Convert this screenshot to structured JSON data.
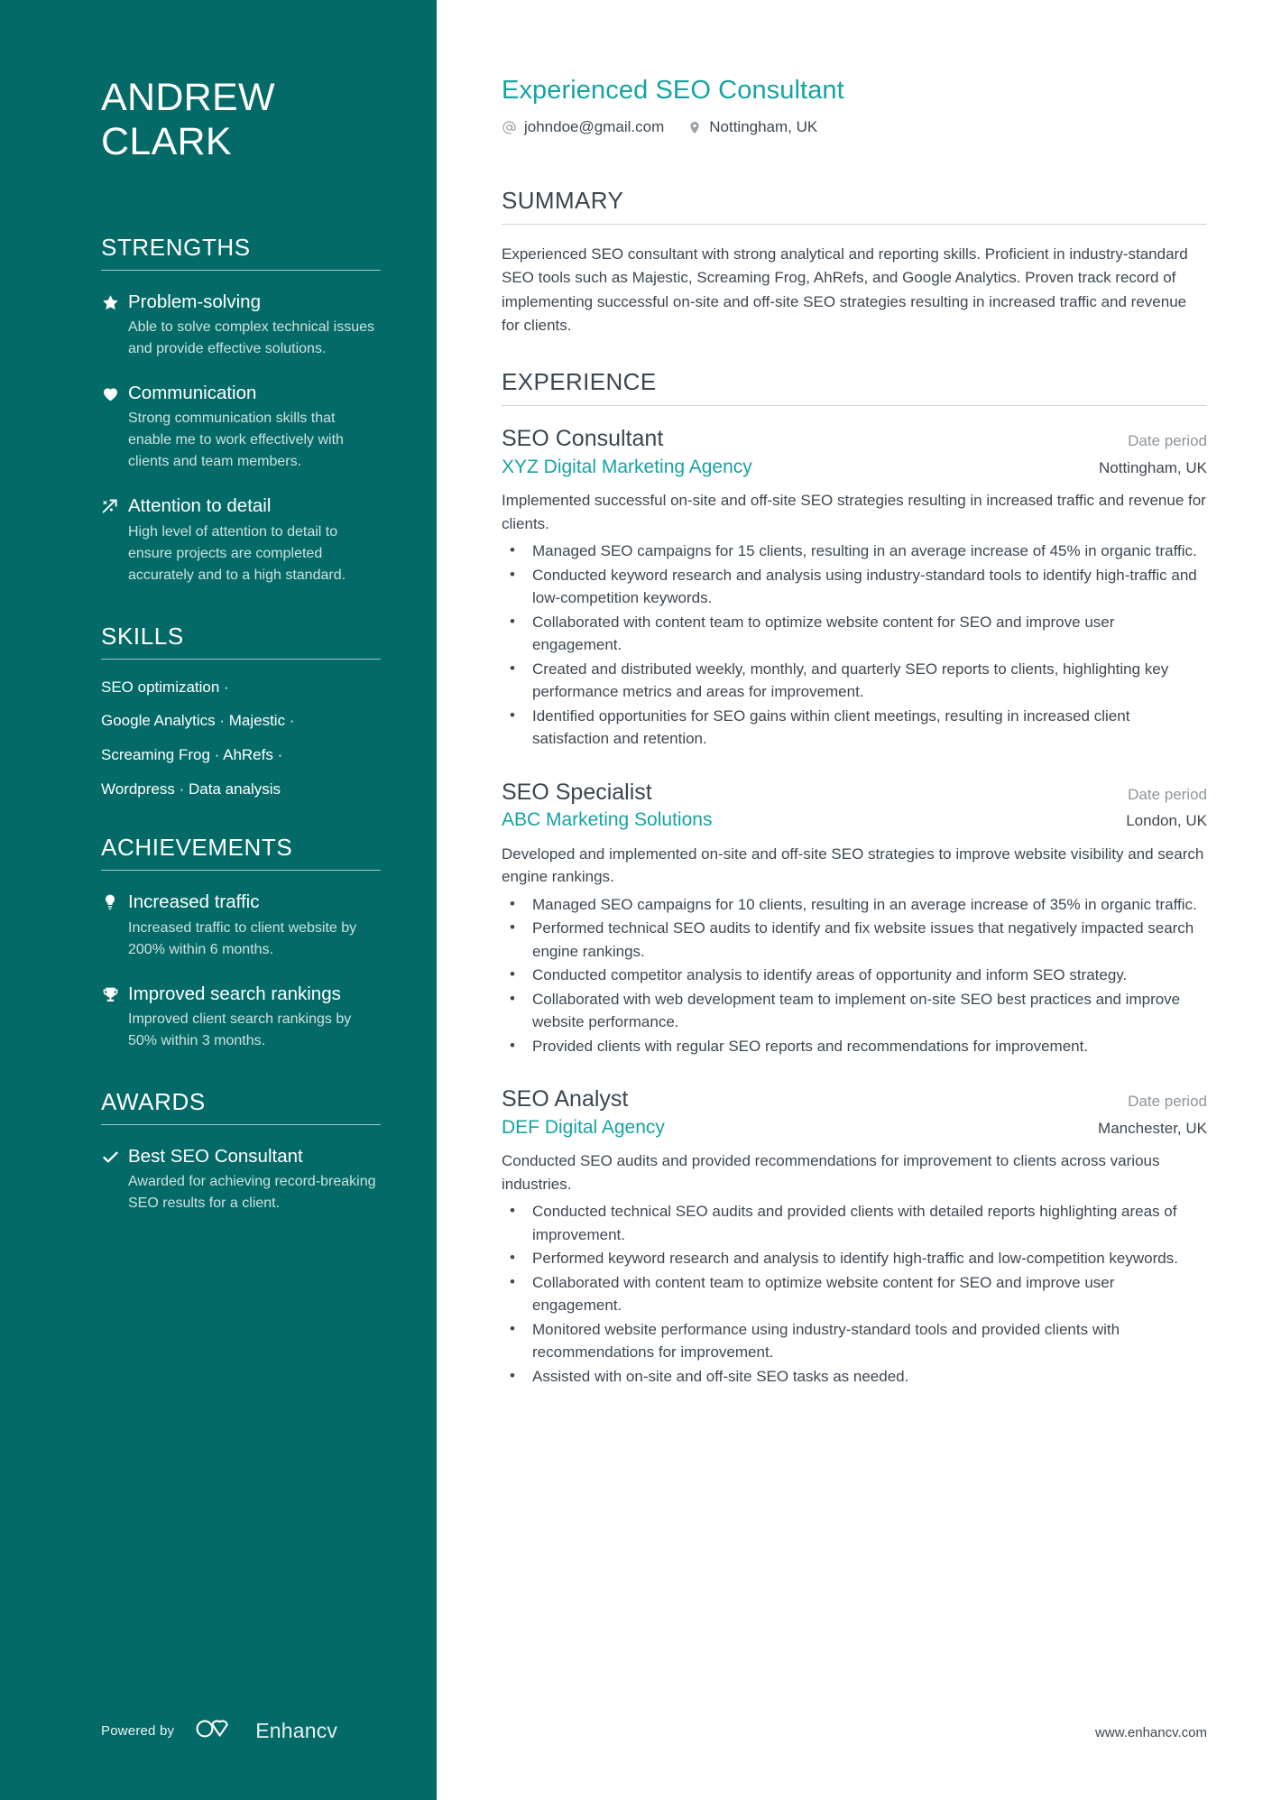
{
  "sidebar": {
    "name_lines": [
      "ANDREW",
      "CLARK"
    ],
    "strengths": {
      "heading": "STRENGTHS",
      "items": [
        {
          "icon": "star-icon",
          "title": "Problem-solving",
          "description": "Able to solve complex technical issues and provide effective solutions."
        },
        {
          "icon": "heart-icon",
          "title": "Communication",
          "description": "Strong communication skills that enable me to work effectively with clients and team members."
        },
        {
          "icon": "sparkle-arrow-icon",
          "title": "Attention to detail",
          "description": "High level of attention to detail to ensure projects are completed accurately and to a high standard."
        }
      ]
    },
    "skills": {
      "heading": "SKILLS",
      "lines": [
        "SEO optimization ·",
        "Google Analytics · Majestic ·",
        "Screaming Frog · AhRefs ·",
        "Wordpress · Data analysis"
      ]
    },
    "achievements": {
      "heading": "ACHIEVEMENTS",
      "items": [
        {
          "icon": "lightbulb-icon",
          "title": "Increased traffic",
          "description": "Increased traffic to client website by 200% within 6 months."
        },
        {
          "icon": "trophy-icon",
          "title": "Improved search rankings",
          "description": "Improved client search rankings by 50% within 3 months."
        }
      ]
    },
    "awards": {
      "heading": "AWARDS",
      "items": [
        {
          "icon": "check-icon",
          "title": "Best SEO Consultant",
          "description": "Awarded for achieving record-breaking SEO results for a client."
        }
      ]
    },
    "footer": {
      "powered_by": "Powered by",
      "brand": "Enhancv"
    }
  },
  "main": {
    "headline": "Experienced SEO Consultant",
    "contact": {
      "email": "johndoe@gmail.com",
      "location": "Nottingham, UK"
    },
    "summary": {
      "heading": "SUMMARY",
      "text": "Experienced SEO consultant with strong analytical and reporting skills. Proficient in industry-standard SEO tools such as Majestic, Screaming Frog, AhRefs, and Google Analytics. Proven track record of implementing successful on-site and off-site SEO strategies resulting in increased traffic and revenue for clients."
    },
    "experience": {
      "heading": "EXPERIENCE",
      "jobs": [
        {
          "title": "SEO Consultant",
          "period": "Date period",
          "company": "XYZ Digital Marketing Agency",
          "location": "Nottingham, UK",
          "summary": "Implemented successful on-site and off-site SEO strategies resulting in increased traffic and revenue for clients.",
          "bullets": [
            "Managed SEO campaigns for 15 clients, resulting in an average increase of 45% in organic traffic.",
            "Conducted keyword research and analysis using industry-standard tools to identify high-traffic and low-competition keywords.",
            "Collaborated with content team to optimize website content for SEO and improve user engagement.",
            "Created and distributed weekly, monthly, and quarterly SEO reports to clients, highlighting key performance metrics and areas for improvement.",
            "Identified opportunities for SEO gains within client meetings, resulting in increased client satisfaction and retention."
          ]
        },
        {
          "title": "SEO Specialist",
          "period": "Date period",
          "company": "ABC Marketing Solutions",
          "location": "London, UK",
          "summary": "Developed and implemented on-site and off-site SEO strategies to improve website visibility and search engine rankings.",
          "bullets": [
            "Managed SEO campaigns for 10 clients, resulting in an average increase of 35% in organic traffic.",
            "Performed technical SEO audits to identify and fix website issues that negatively impacted search engine rankings.",
            "Conducted competitor analysis to identify areas of opportunity and inform SEO strategy.",
            "Collaborated with web development team to implement on-site SEO best practices and improve website performance.",
            "Provided clients with regular SEO reports and recommendations for improvement."
          ]
        },
        {
          "title": "SEO Analyst",
          "period": "Date period",
          "company": "DEF Digital Agency",
          "location": "Manchester, UK",
          "summary": "Conducted SEO audits and provided recommendations for improvement to clients across various industries.",
          "bullets": [
            "Conducted technical SEO audits and provided clients with detailed reports highlighting areas of improvement.",
            "Performed keyword research and analysis to identify high-traffic and low-competition keywords.",
            "Collaborated with content team to optimize website content for SEO and improve user engagement.",
            "Monitored website performance using industry-standard tools and provided clients with recommendations for improvement.",
            "Assisted with on-site and off-site SEO tasks as needed."
          ]
        }
      ]
    },
    "website": "www.enhancv.com"
  },
  "colors": {
    "sidebar_bg": "#046a67",
    "accent": "#17a3a3",
    "body_text": "#3d4852",
    "muted_text": "#8d969d"
  }
}
